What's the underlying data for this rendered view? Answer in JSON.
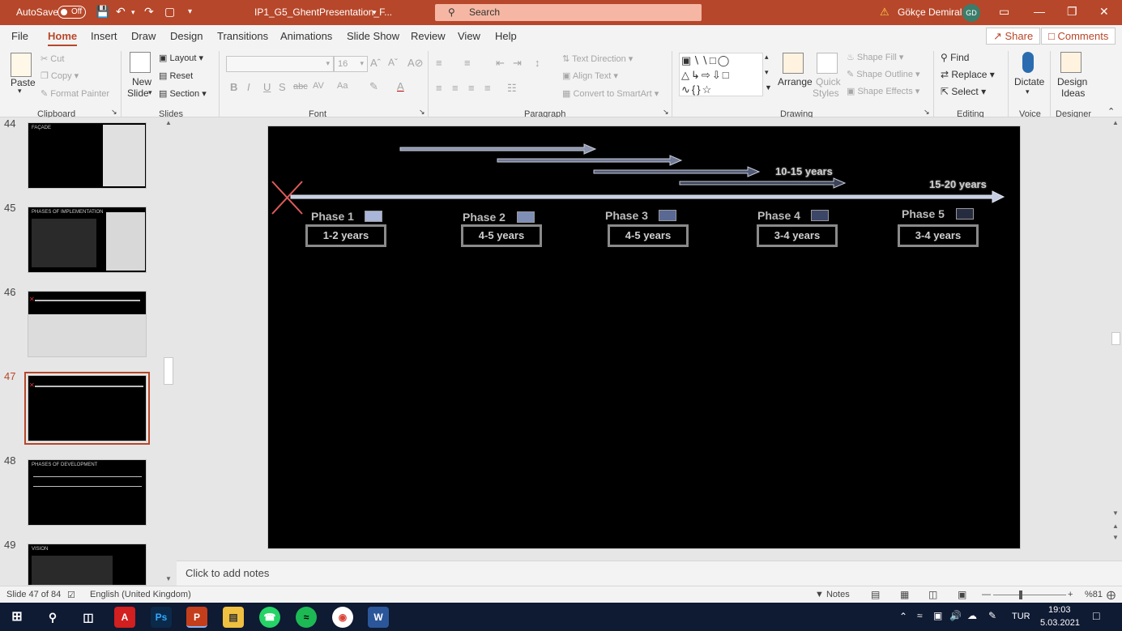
{
  "titlebar": {
    "autosave_label": "AutoSave",
    "autosave_state": "Off",
    "file_name": "IP1_G5_GhentPresentation_F...",
    "search_placeholder": "Search",
    "user_name": "Gökçe Demiral",
    "user_initials": "GD",
    "colors": {
      "bar": "#b7472a",
      "search": "#f5b7a3"
    }
  },
  "menu": {
    "tabs": [
      "File",
      "Home",
      "Insert",
      "Draw",
      "Design",
      "Transitions",
      "Animations",
      "Slide Show",
      "Review",
      "View",
      "Help"
    ],
    "active_tab": "Home",
    "share_label": "Share",
    "comments_label": "Comments"
  },
  "ribbon": {
    "clipboard": {
      "paste": "Paste",
      "cut": "Cut",
      "copy": "Copy",
      "format_painter": "Format Painter",
      "group": "Clipboard"
    },
    "slides": {
      "new_slide_1": "New",
      "new_slide_2": "Slide",
      "layout": "Layout",
      "reset": "Reset",
      "section": "Section",
      "group": "Slides"
    },
    "font": {
      "font_size": "16",
      "group": "Font",
      "bold": "B",
      "italic": "I",
      "underline": "U",
      "shadow": "S",
      "strike": "abc",
      "spacing": "AV",
      "change_case": "Aa"
    },
    "paragraph": {
      "text_direction": "Text Direction",
      "align_text": "Align Text",
      "convert_smartart": "Convert to SmartArt",
      "group": "Paragraph"
    },
    "drawing": {
      "arrange": "Arrange",
      "quick_1": "Quick",
      "quick_2": "Styles",
      "shape_fill": "Shape Fill",
      "shape_outline": "Shape Outline",
      "shape_effects": "Shape Effects",
      "group": "Drawing"
    },
    "editing": {
      "find": "Find",
      "replace": "Replace",
      "select": "Select",
      "group": "Editing"
    },
    "voice": {
      "dictate": "Dictate",
      "group": "Voice"
    },
    "designer": {
      "design_1": "Design",
      "design_2": "Ideas",
      "group": "Designer"
    }
  },
  "slide_panel": {
    "slides": [
      {
        "number": "44",
        "title": "FAÇADE"
      },
      {
        "number": "45",
        "title": "PHASES OF IMPLEMENTATION"
      },
      {
        "number": "46",
        "title": ""
      },
      {
        "number": "47",
        "title": ""
      },
      {
        "number": "48",
        "title": "PHASES OF DEVELOPMENT"
      },
      {
        "number": "49",
        "title": "VISION"
      }
    ],
    "current": "47"
  },
  "slide": {
    "duration_labels": [
      "10-15 years",
      "15-20 years"
    ],
    "phases": [
      {
        "label": "Phase 1",
        "years": "1-2 years",
        "color": "#a9b6d9"
      },
      {
        "label": "Phase 2",
        "years": "4-5 years",
        "color": "#7f8eb5"
      },
      {
        "label": "Phase 3",
        "years": "4-5 years",
        "color": "#5a6994"
      },
      {
        "label": "Phase 4",
        "years": "3-4 years",
        "color": "#3c4666"
      },
      {
        "label": "Phase 5",
        "years": "3-4 years",
        "color": "#262c40"
      }
    ]
  },
  "notes": {
    "placeholder": "Click to add notes"
  },
  "status": {
    "slide_counter": "Slide 47 of 84",
    "language": "English (United Kingdom)",
    "notes_label": "Notes",
    "zoom": "%81"
  },
  "taskbar": {
    "language": "TUR",
    "time": "19:03",
    "date": "5.03.2021"
  }
}
